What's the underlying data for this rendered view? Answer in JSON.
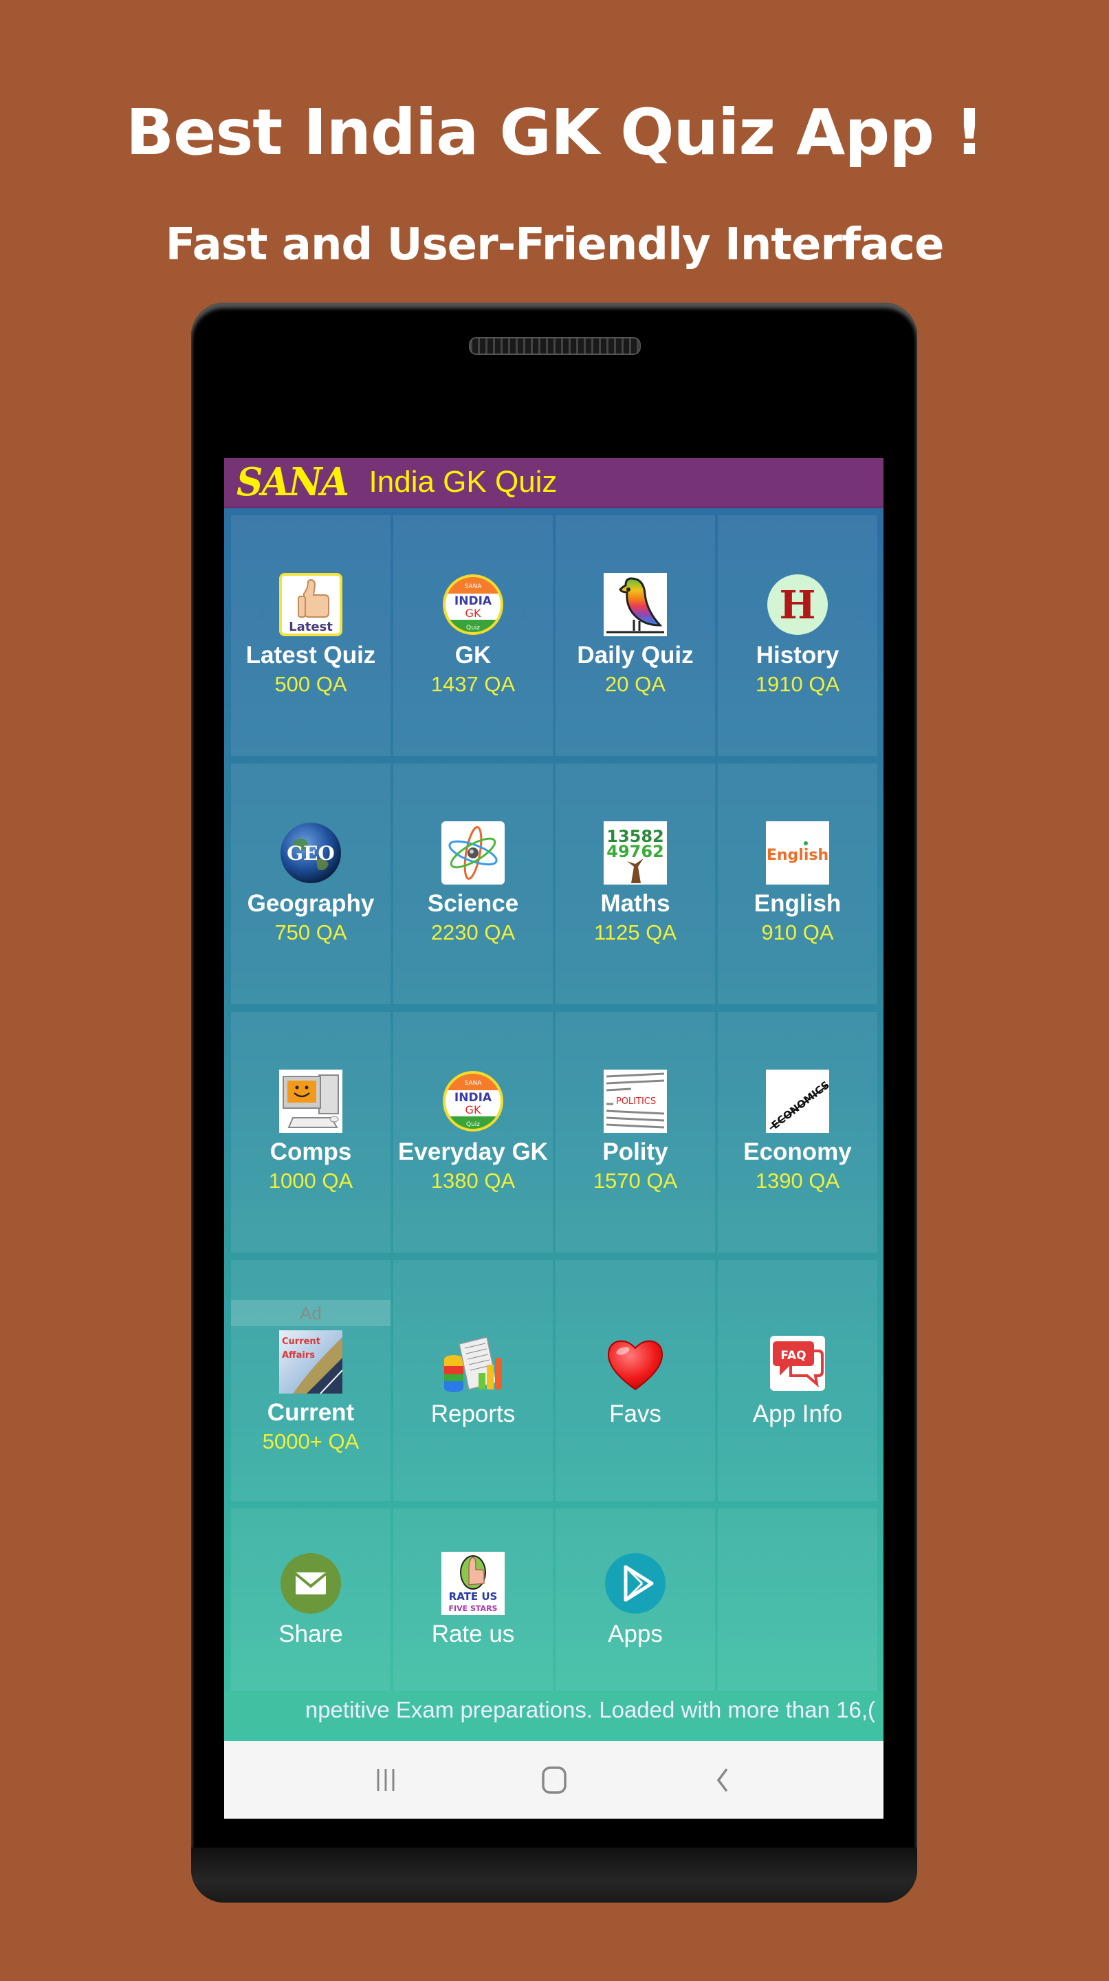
{
  "promo": {
    "title": "Best India GK Quiz App !",
    "subtitle": "Fast and User-Friendly Interface"
  },
  "app": {
    "brand": "SANA",
    "title": "India GK Quiz",
    "colors": {
      "app_bar": "#763477",
      "title_text": "#fff200",
      "count_text": "#f0f03a",
      "background": "#a25832"
    }
  },
  "tiles": [
    {
      "label": "Latest Quiz",
      "count": "500 QA",
      "icon": "thumbs-up-latest-icon"
    },
    {
      "label": "GK",
      "count": "1437 QA",
      "icon": "india-gk-badge-icon"
    },
    {
      "label": "Daily Quiz",
      "count": "20 QA",
      "icon": "rainbow-bird-icon"
    },
    {
      "label": "History",
      "count": "1910 QA",
      "icon": "history-h-icon"
    },
    {
      "label": "Geography",
      "count": "750 QA",
      "icon": "geo-globe-icon"
    },
    {
      "label": "Science",
      "count": "2230 QA",
      "icon": "atom-icon"
    },
    {
      "label": "Maths",
      "count": "1125 QA",
      "icon": "number-tree-icon"
    },
    {
      "label": "English",
      "count": "910 QA",
      "icon": "english-word-icon"
    },
    {
      "label": "Comps",
      "count": "1000 QA",
      "icon": "computer-icon"
    },
    {
      "label": "Everyday GK",
      "count": "1380 QA",
      "icon": "india-gk-badge-icon"
    },
    {
      "label": "Polity",
      "count": "1570 QA",
      "icon": "politics-icon"
    },
    {
      "label": "Economy",
      "count": "1390 QA",
      "icon": "economics-icon"
    },
    {
      "label": "Current",
      "count": "5000+ QA",
      "icon": "current-affairs-icon",
      "badge": "Ad"
    },
    {
      "label": "Reports",
      "icon": "reports-chart-icon"
    },
    {
      "label": "Favs",
      "icon": "heart-icon"
    },
    {
      "label": "App Info",
      "icon": "faq-icon"
    },
    {
      "label": "Share",
      "icon": "mail-share-icon"
    },
    {
      "label": "Rate us",
      "icon": "rate-us-icon"
    },
    {
      "label": "Apps",
      "icon": "play-store-icon"
    }
  ],
  "icon_text": {
    "latest": "Latest",
    "sana": "SANA",
    "india": "INDIA",
    "gk": "GK",
    "quiz": "Quiz",
    "h": "H",
    "geo": "GEO",
    "math_top": "13582",
    "math_bottom": "49762",
    "english": "English",
    "politics": "POLITICS",
    "economics": "ECONOMICS",
    "current": "Current",
    "affairs": "Affairs",
    "faq": "FAQ",
    "rate_us": "RATE US",
    "five_stars": "FIVE STARS"
  },
  "ticker": {
    "text": "npetitive Exam preparations. Loaded with more than 16,("
  },
  "nav": {
    "recents": "recents-icon",
    "home": "home-icon",
    "back": "back-icon"
  }
}
